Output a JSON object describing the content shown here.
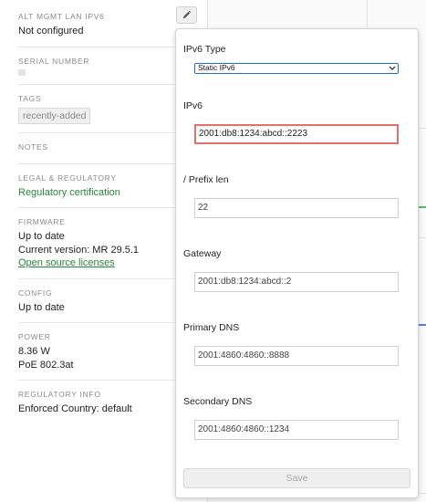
{
  "left_panel": {
    "alt_mgmt": {
      "label": "ALT MGMT LAN IPV6",
      "value": "Not configured"
    },
    "serial": {
      "label": "SERIAL NUMBER"
    },
    "tags": {
      "label": "TAGS",
      "tag": "recently-added"
    },
    "notes": {
      "label": "NOTES"
    },
    "legal": {
      "label": "LEGAL & REGULATORY",
      "link": "Regulatory certification"
    },
    "firmware": {
      "label": "FIRMWARE",
      "status": "Up to date",
      "version": "Current version: MR 29.5.1",
      "link": "Open source licenses"
    },
    "config": {
      "label": "CONFIG",
      "value": "Up to date"
    },
    "power": {
      "label": "POWER",
      "watts": "8.36 W",
      "poe": "PoE 802.3at"
    },
    "regulatory_info": {
      "label": "REGULATORY INFO",
      "value": "Enforced Country: default"
    }
  },
  "popover": {
    "ipv6_type": {
      "label": "IPv6 Type",
      "selected": "Static IPv6"
    },
    "ipv6": {
      "label": "IPv6",
      "value": "2001:db8:1234:abcd::2223"
    },
    "prefix": {
      "label": "/ Prefix len",
      "value": "22"
    },
    "gateway": {
      "label": "Gateway",
      "value": "2001:db8:1234:abcd::2"
    },
    "primary_dns": {
      "label": "Primary DNS",
      "value": "2001:4860:4860::8888"
    },
    "secondary_dns": {
      "label": "Secondary DNS",
      "value": "2001:4860:4860::1234"
    },
    "save_label": "Save"
  },
  "colors": {
    "accent_green": "#27873a",
    "select_border": "#1f6fd1",
    "highlight_border": "#e0726c"
  },
  "icons": {
    "edit": "pencil-icon",
    "dropdown": "chevron-down-icon"
  }
}
